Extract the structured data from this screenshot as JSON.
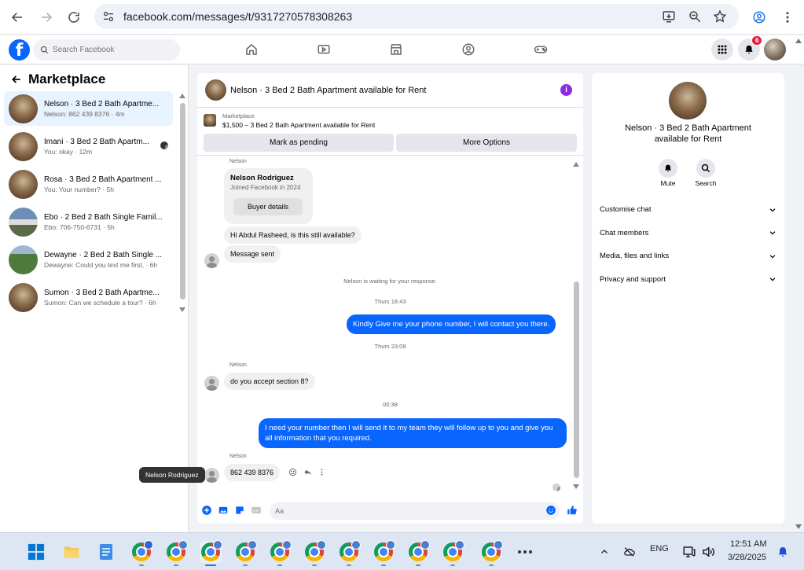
{
  "browser": {
    "url": "facebook.com/messages/t/9317270578308263"
  },
  "fbbar": {
    "search_placeholder": "Search Facebook",
    "notifications_count": "6"
  },
  "left": {
    "title": "Marketplace",
    "conversations": [
      {
        "name": "Nelson · 3 Bed 2 Bath Apartme...",
        "preview": "Nelson: 862 439 8376 · 4m",
        "thumb": "room",
        "active": true
      },
      {
        "name": "Imani · 3 Bed 2 Bath Apartm...",
        "preview": "You: okay · 12m",
        "thumb": "room",
        "active": false
      },
      {
        "name": "Rosa · 3 Bed 2 Bath Apartment ...",
        "preview": "You: Your number? · 5h",
        "thumb": "room",
        "active": false
      },
      {
        "name": "Ebo · 2 Bed 2 Bath Single Famil...",
        "preview": "Ebo: 706-750-6731 · 5h",
        "thumb": "house",
        "active": false
      },
      {
        "name": "Dewayne · 2 Bed 2 Bath Single ...",
        "preview": "Dewayne: Could you text me first, · 6h",
        "thumb": "green",
        "active": false
      },
      {
        "name": "Sumon · 3 Bed 2 Bath Apartme...",
        "preview": "Sumon: Can we schedule a tour? · 6h",
        "thumb": "room",
        "active": false
      }
    ]
  },
  "chat": {
    "title": "Nelson · 3 Bed 2 Bath Apartment available for Rent",
    "listing_label": "Marketplace",
    "listing_text": "$1,500 – 3 Bed 2 Bath Apartment available for Rent",
    "mark_pending": "Mark as pending",
    "more_options": "More Options",
    "sender_top": "Nelson",
    "profile_name": "Nelson Rodriguez",
    "profile_joined": "Joined Facebook in 2024",
    "buyer_details": "Buyer details",
    "msg_available": "Hi Abdul Rasheed, is this still available?",
    "msg_sent": "Message sent",
    "waiting": "Nelson is waiting for your response.",
    "time1": "Thurs 18:43",
    "out1": "Kindly Give me your phone number, I will contact you there.",
    "time2": "Thurs 23:09",
    "sender2": "Nelson",
    "msg_section8": "do you accept section 8?",
    "time3": "00:38",
    "out2": "I need your number then I will send it to my team they will follow up to you and give you all information that you required.",
    "sender3": "Nelson",
    "msg_number": "862 439 8376",
    "input_placeholder": "Aa",
    "tooltip": "Nelson Rodriguez"
  },
  "right": {
    "title": "Nelson · 3 Bed 2 Bath Apartment available for Rent",
    "mute": "Mute",
    "search": "Search",
    "sections": [
      "Customise chat",
      "Chat members",
      "Media, files and links",
      "Privacy and support"
    ]
  },
  "taskbar": {
    "lang": "ENG",
    "time": "12:51 AM",
    "date": "3/28/2025"
  },
  "colors": {
    "fb_blue": "#0866ff",
    "info_purple": "#8a2be2"
  }
}
